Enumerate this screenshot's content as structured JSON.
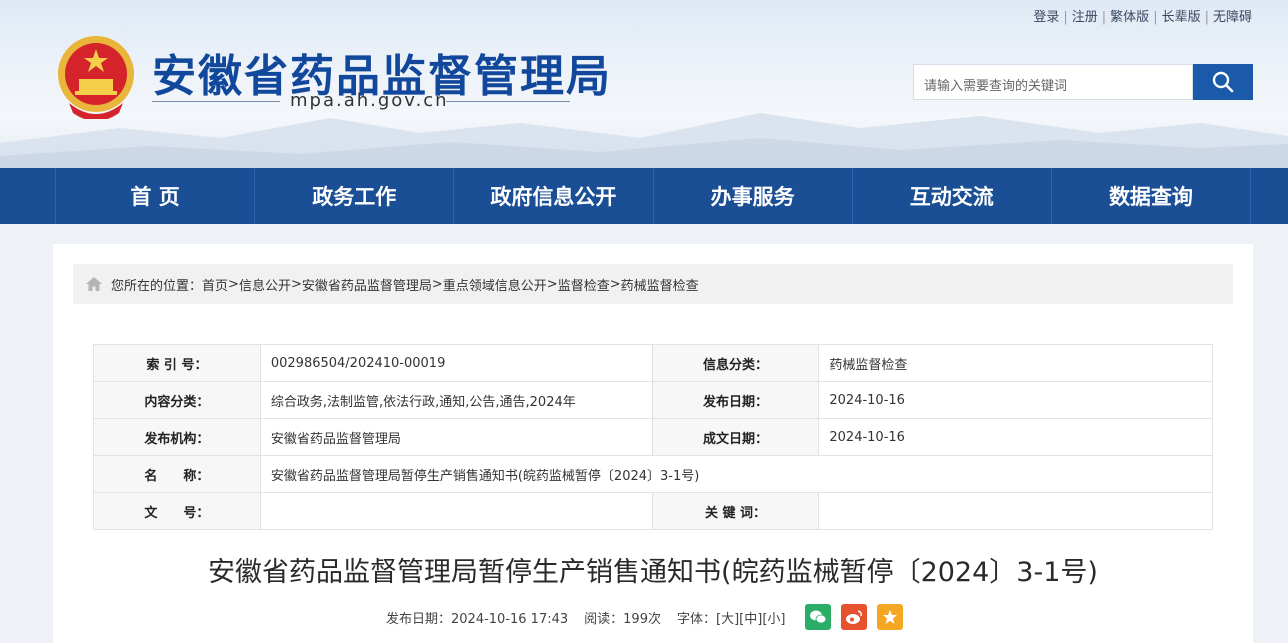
{
  "header": {
    "toplinks": [
      "登录",
      "注册",
      "繁体版",
      "长辈版",
      "无障碍"
    ],
    "site_title": "安徽省药品监督管理局",
    "site_domain": "mpa.ah.gov.cn",
    "search_placeholder": "请输入需要查询的关键词"
  },
  "nav": [
    "首 页",
    "政务工作",
    "政府信息公开",
    "办事服务",
    "互动交流",
    "数据查询"
  ],
  "breadcrumb": {
    "prefix": "您所在的位置：",
    "items": [
      "首页",
      "信息公开",
      "安徽省药品监督管理局",
      "重点领域信息公开",
      "监督检查",
      "药械监督检查"
    ],
    "separator": " > "
  },
  "meta": {
    "index_label": "索 引 号：",
    "index_value": "002986504/202410-00019",
    "category_label": "信息分类：",
    "category_value": "药械监督检查",
    "content_label": "内容分类：",
    "content_value": "综合政务,法制监管,依法行政,通知,公告,通告,2024年",
    "pubdate_label": "发布日期：",
    "pubdate_value": "2024-10-16",
    "org_label": "发布机构：",
    "org_value": "安徽省药品监督管理局",
    "doc_date_label": "成文日期：",
    "doc_date_value": "2024-10-16",
    "name_label": "名　　称：",
    "name_value": "安徽省药品监督管理局暂停生产销售通知书(皖药监械暂停〔2024〕3-1号)",
    "docnum_label": "文　　号：",
    "docnum_value": "",
    "keyword_label": "关 键 词：",
    "keyword_value": ""
  },
  "article": {
    "title": "安徽省药品监督管理局暂停生产销售通知书(皖药监械暂停〔2024〕3-1号)",
    "publish": "发布日期：2024-10-16 17:43",
    "reads": "阅读：199次",
    "font_label": "字体：",
    "font_large": "[大]",
    "font_medium": "[中]",
    "font_small": "[小]"
  },
  "colors": {
    "nav_bg": "#1a4e95",
    "title_blue": "#12489b",
    "wechat": "#2aae67",
    "weibo": "#e6512e",
    "favorite": "#f5a623"
  }
}
